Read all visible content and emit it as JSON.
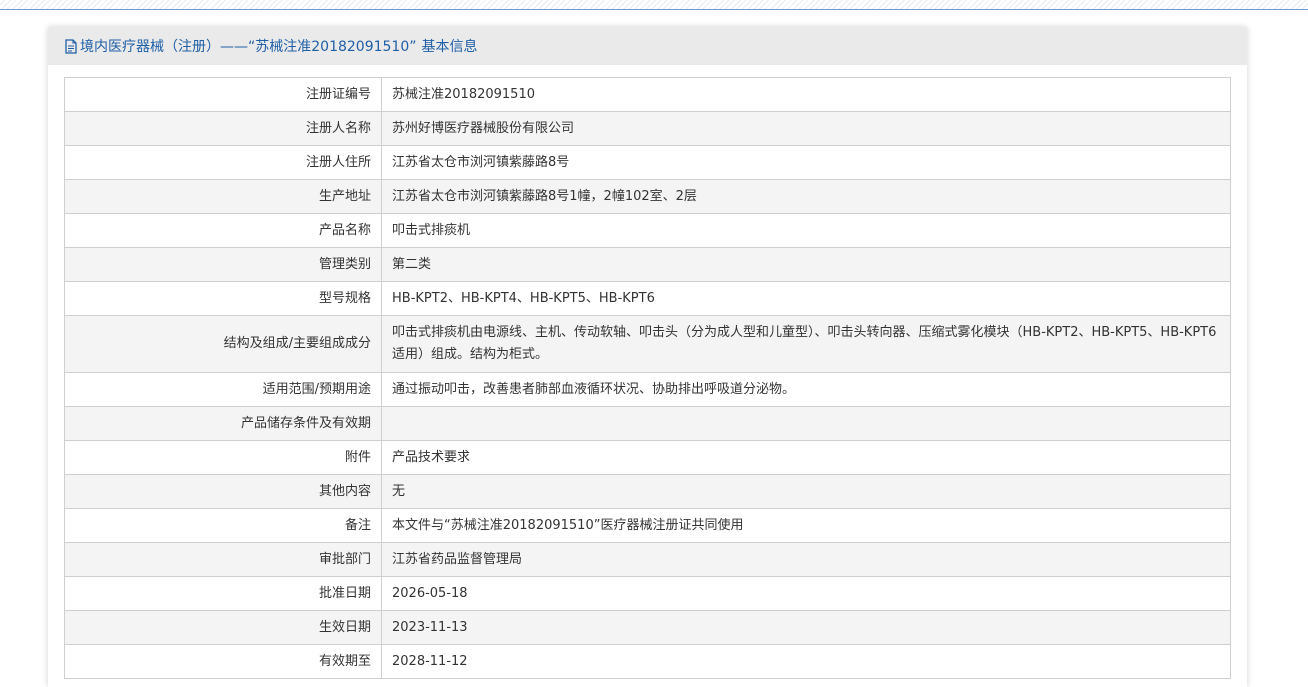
{
  "header": {
    "prefix": "境内医疗器械（注册）——",
    "quoted_number": "“苏械注准20182091510”",
    "suffix": "基本信息"
  },
  "rows": [
    {
      "label": "注册证编号",
      "value": "苏械注准20182091510"
    },
    {
      "label": "注册人名称",
      "value": "苏州好博医疗器械股份有限公司"
    },
    {
      "label": "注册人住所",
      "value": "江苏省太仓市浏河镇紫藤路8号"
    },
    {
      "label": "生产地址",
      "value": "江苏省太仓市浏河镇紫藤路8号1幢，2幢102室、2层"
    },
    {
      "label": "产品名称",
      "value": "叩击式排痰机"
    },
    {
      "label": "管理类别",
      "value": "第二类"
    },
    {
      "label": "型号规格",
      "value": "HB-KPT2、HB-KPT4、HB-KPT5、HB-KPT6"
    },
    {
      "label": "结构及组成/主要组成成分",
      "value": "叩击式排痰机由电源线、主机、传动软轴、叩击头（分为成人型和儿童型）、叩击头转向器、压缩式雾化模块（HB-KPT2、HB-KPT5、HB-KPT6适用）组成。结构为柜式。"
    },
    {
      "label": "适用范围/预期用途",
      "value": "通过振动叩击，改善患者肺部血液循环状况、协助排出呼吸道分泌物。"
    },
    {
      "label": "产品储存条件及有效期",
      "value": ""
    },
    {
      "label": "附件",
      "value": "产品技术要求"
    },
    {
      "label": "其他内容",
      "value": "无"
    },
    {
      "label": "备注",
      "value": "本文件与“苏械注准20182091510”医疗器械注册证共同使用"
    },
    {
      "label": "审批部门",
      "value": "江苏省药品监督管理局"
    },
    {
      "label": "批准日期",
      "value": "2026-05-18"
    },
    {
      "label": "生效日期",
      "value": "2023-11-13"
    },
    {
      "label": "有效期至",
      "value": "2028-11-12"
    }
  ]
}
